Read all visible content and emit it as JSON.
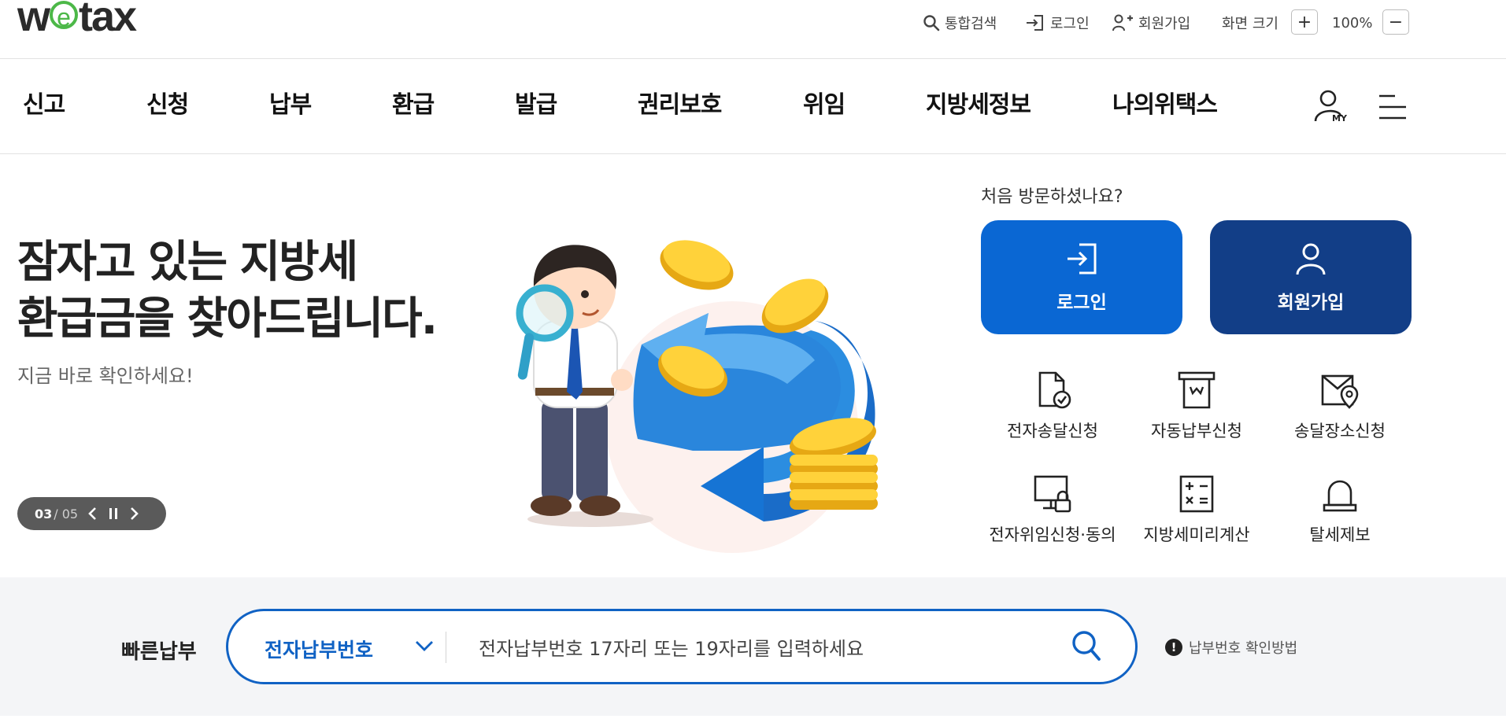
{
  "logo": {
    "pre": "w",
    "e": "e",
    "post": "tax"
  },
  "util": {
    "search": "통합검색",
    "login": "로그인",
    "signup": "회원가입",
    "zoom_label": "화면 크기",
    "zoom_in": "+",
    "zoom_value": "100%",
    "zoom_out": "−"
  },
  "nav": {
    "items": [
      "신고",
      "신청",
      "납부",
      "환급",
      "발급",
      "권리보호",
      "위임",
      "지방세정보",
      "나의위택스"
    ],
    "my_badge": "MY"
  },
  "hero": {
    "title_line1": "잠자고 있는 지방세",
    "title_line2": "환급금을 찾아드립니다.",
    "subtitle": "지금 바로 확인하세요!",
    "slide_current": "03",
    "slide_total": "/ 05"
  },
  "panel": {
    "first_visit": "처음 방문하셨나요?",
    "login": "로그인",
    "signup": "회원가입",
    "login_color": "#0a67d3",
    "signup_color": "#123e87",
    "services": [
      {
        "label": "전자송달신청",
        "icon": "document-check-icon"
      },
      {
        "label": "자동납부신청",
        "icon": "auto-payment-icon"
      },
      {
        "label": "송달장소신청",
        "icon": "envelope-location-icon"
      },
      {
        "label": "전자위임신청·동의",
        "icon": "monitor-lock-icon"
      },
      {
        "label": "지방세미리계산",
        "icon": "calculator-icon"
      },
      {
        "label": "탈세제보",
        "icon": "alarm-bell-icon"
      }
    ]
  },
  "quickpay": {
    "label": "빠른납부",
    "select_value": "전자납부번호",
    "input_placeholder": "전자납부번호 17자리 또는 19자리를 입력하세요",
    "help_icon": "!",
    "help": "납부번호 확인방법",
    "accent": "#1062c4"
  }
}
